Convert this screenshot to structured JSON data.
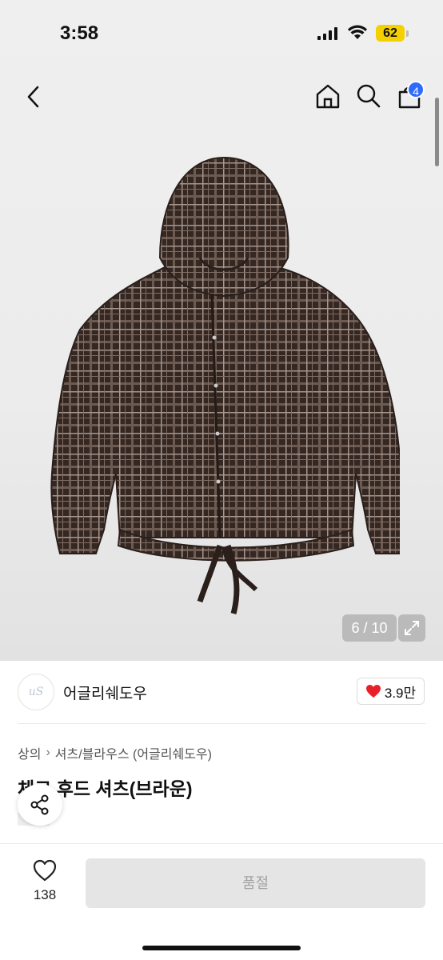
{
  "status_bar": {
    "time": "3:58",
    "battery": "62"
  },
  "nav": {
    "cart_count": "4"
  },
  "gallery": {
    "counter": "6 / 10"
  },
  "brand": {
    "logo_text": "uS",
    "name": "어글리쉐도우",
    "likes": "3.9만"
  },
  "breadcrumb": {
    "category": "상의",
    "subcategory": "셔츠/블라우스 (어글리쉐도우)"
  },
  "product": {
    "title": "체크 후드 셔츠(브라운)"
  },
  "bottom_bar": {
    "wish_count": "138",
    "buy_label": "품절"
  },
  "colors": {
    "accent_blue": "#2f6bff",
    "heart_red": "#e8202a",
    "battery_yellow": "#f5d000",
    "plaid_brown": "#3a2c27"
  },
  "icons": [
    "back-icon",
    "home-icon",
    "search-icon",
    "bag-icon",
    "expand-icon",
    "heart-icon",
    "share-icon",
    "heart-outline-icon"
  ]
}
